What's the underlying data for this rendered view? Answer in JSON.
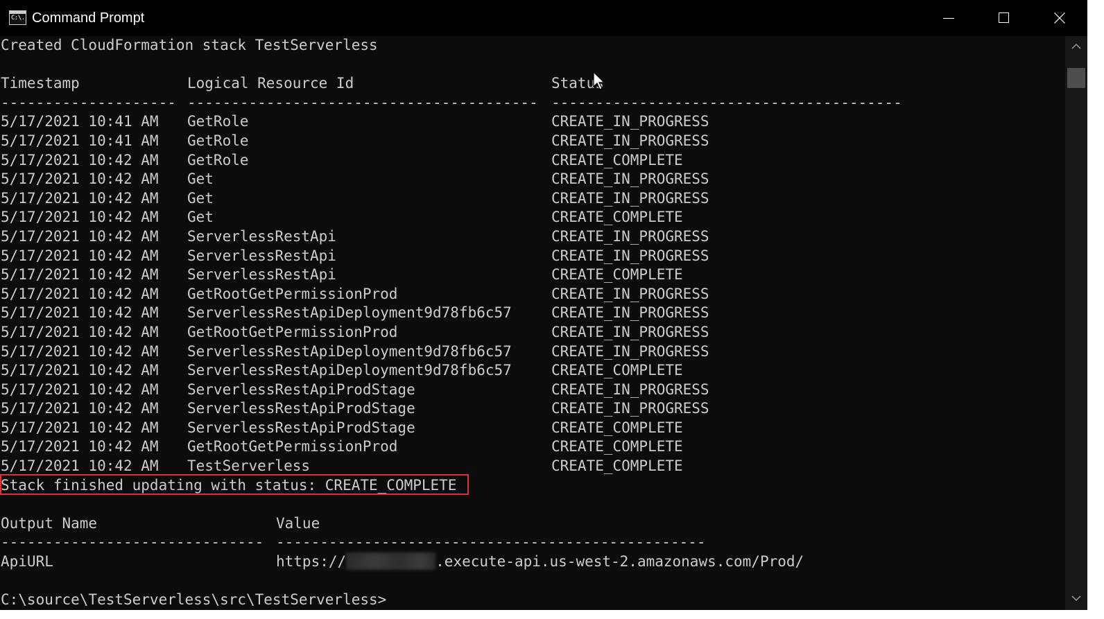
{
  "window": {
    "title": "Command Prompt",
    "icon": "cmd-icon",
    "icon_text": "C:\\."
  },
  "console": {
    "created_line": "Created CloudFormation stack TestServerless",
    "events_header": {
      "timestamp": "Timestamp",
      "logical_id": "Logical Resource Id",
      "status": "Status"
    },
    "events_separator": {
      "timestamp": "--------------------",
      "logical_id": "----------------------------------------",
      "status": "----------------------------------------"
    },
    "events": [
      {
        "timestamp": "5/17/2021 10:41 AM",
        "logical_id": "GetRole",
        "status": "CREATE_IN_PROGRESS"
      },
      {
        "timestamp": "5/17/2021 10:41 AM",
        "logical_id": "GetRole",
        "status": "CREATE_IN_PROGRESS"
      },
      {
        "timestamp": "5/17/2021 10:42 AM",
        "logical_id": "GetRole",
        "status": "CREATE_COMPLETE"
      },
      {
        "timestamp": "5/17/2021 10:42 AM",
        "logical_id": "Get",
        "status": "CREATE_IN_PROGRESS"
      },
      {
        "timestamp": "5/17/2021 10:42 AM",
        "logical_id": "Get",
        "status": "CREATE_IN_PROGRESS"
      },
      {
        "timestamp": "5/17/2021 10:42 AM",
        "logical_id": "Get",
        "status": "CREATE_COMPLETE"
      },
      {
        "timestamp": "5/17/2021 10:42 AM",
        "logical_id": "ServerlessRestApi",
        "status": "CREATE_IN_PROGRESS"
      },
      {
        "timestamp": "5/17/2021 10:42 AM",
        "logical_id": "ServerlessRestApi",
        "status": "CREATE_IN_PROGRESS"
      },
      {
        "timestamp": "5/17/2021 10:42 AM",
        "logical_id": "ServerlessRestApi",
        "status": "CREATE_COMPLETE"
      },
      {
        "timestamp": "5/17/2021 10:42 AM",
        "logical_id": "GetRootGetPermissionProd",
        "status": "CREATE_IN_PROGRESS"
      },
      {
        "timestamp": "5/17/2021 10:42 AM",
        "logical_id": "ServerlessRestApiDeployment9d78fb6c57",
        "status": "CREATE_IN_PROGRESS"
      },
      {
        "timestamp": "5/17/2021 10:42 AM",
        "logical_id": "GetRootGetPermissionProd",
        "status": "CREATE_IN_PROGRESS"
      },
      {
        "timestamp": "5/17/2021 10:42 AM",
        "logical_id": "ServerlessRestApiDeployment9d78fb6c57",
        "status": "CREATE_IN_PROGRESS"
      },
      {
        "timestamp": "5/17/2021 10:42 AM",
        "logical_id": "ServerlessRestApiDeployment9d78fb6c57",
        "status": "CREATE_COMPLETE"
      },
      {
        "timestamp": "5/17/2021 10:42 AM",
        "logical_id": "ServerlessRestApiProdStage",
        "status": "CREATE_IN_PROGRESS"
      },
      {
        "timestamp": "5/17/2021 10:42 AM",
        "logical_id": "ServerlessRestApiProdStage",
        "status": "CREATE_IN_PROGRESS"
      },
      {
        "timestamp": "5/17/2021 10:42 AM",
        "logical_id": "ServerlessRestApiProdStage",
        "status": "CREATE_COMPLETE"
      },
      {
        "timestamp": "5/17/2021 10:42 AM",
        "logical_id": "GetRootGetPermissionProd",
        "status": "CREATE_COMPLETE"
      },
      {
        "timestamp": "5/17/2021 10:42 AM",
        "logical_id": "TestServerless",
        "status": "CREATE_COMPLETE"
      }
    ],
    "finished_line": "Stack finished updating with status: CREATE_COMPLETE",
    "outputs_header": {
      "name": "Output Name",
      "value": "Value"
    },
    "outputs_separator": {
      "name": "------------------------------",
      "value": "-------------------------------------------------"
    },
    "outputs": [
      {
        "name": "ApiURL",
        "value_prefix": "https://",
        "value_suffix": ".execute-api.us-west-2.amazonaws.com/Prod/"
      }
    ],
    "prompt": "C:\\source\\TestServerless\\src\\TestServerless>"
  },
  "colors": {
    "console_bg": "#0c0c0c",
    "console_text": "#cccccc",
    "titlebar_bg": "#000000",
    "highlight_border": "#e0322e"
  }
}
